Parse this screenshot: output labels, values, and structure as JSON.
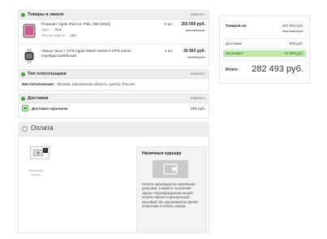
{
  "sections": {
    "goods": {
      "title": "Товары в заказе",
      "edit": "изменить",
      "items": [
        {
          "name": "Планшет Apple iPad Air, Pink, 256 (2021)",
          "color_label": "Цвет:",
          "color_value": "Pink",
          "memory_label": "Объем памяти:",
          "memory_value": "256",
          "qty": "2 шт",
          "price": "255 000 руб.",
          "old_price": "280 000 руб."
        },
        {
          "name": "Умные часы с GPS Apple Watch Series 6 GPS 44mm серебристый/белый",
          "qty": "1 шт",
          "price": "26 993 руб.",
          "old_price": "29 999 руб."
        }
      ]
    },
    "payer": {
      "title": "Тип плательщика",
      "edit": "изменить",
      "location_label": "Местоположение:",
      "location_value": "Москва, Московская область, Центр, Россия"
    },
    "delivery": {
      "title": "Доставка",
      "edit": "изменить",
      "method": "Доставка курьером",
      "price": "500 руб."
    },
    "payment": {
      "title": "Оплата",
      "method_label": "Наличные курьер",
      "info_title": "Наличные курьеру",
      "info_text": "Оплата производится наличными деньгами, в момент получения заказа. Подтверждением вашей оплаты является фискальный кассовый чек, вручаемый во время получения и оплаты заказа."
    }
  },
  "summary": {
    "goods_label": "Товаров на:",
    "goods_value": "281 993 руб.",
    "goods_old": "309 999 руб.",
    "delivery_label": "Доставка:",
    "delivery_value": "500 руб.",
    "economy_label": "Экономия:",
    "economy_value": "33 998 руб.",
    "total_label": "Итого:",
    "total_value": "282 493 руб."
  },
  "colors": {
    "accent_green": "#3aa935",
    "economy_bg": "#bde8a6"
  },
  "icons": {
    "section": "green-dot-icon",
    "tablet": "tablet-icon",
    "watch": "watch-icon",
    "courier": "courier-icon",
    "cash": "cash-icon",
    "wallet": "wallet-icon",
    "clock": "clock-icon"
  }
}
